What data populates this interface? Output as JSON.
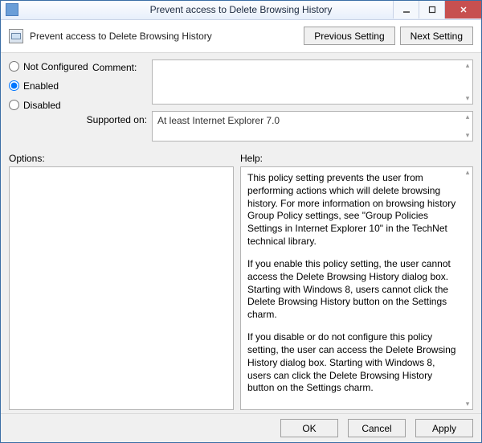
{
  "window": {
    "title": "Prevent access to Delete Browsing History"
  },
  "header": {
    "title": "Prevent access to Delete Browsing History",
    "prev_btn": "Previous Setting",
    "next_btn": "Next Setting"
  },
  "state": {
    "not_configured_label": "Not Configured",
    "enabled_label": "Enabled",
    "disabled_label": "Disabled",
    "selected": "enabled"
  },
  "comment": {
    "label": "Comment:",
    "value": ""
  },
  "supported": {
    "label": "Supported on:",
    "value": "At least Internet Explorer 7.0"
  },
  "options": {
    "label": "Options:"
  },
  "help": {
    "label": "Help:",
    "p1": "This policy setting prevents the user from performing actions which will delete browsing history. For more information on browsing history Group Policy settings, see \"Group Policies Settings in Internet Explorer 10\" in the TechNet technical library.",
    "p2": "If you enable this policy setting, the user cannot access the Delete Browsing History dialog box. Starting with Windows 8, users cannot click the Delete Browsing History button on the Settings charm.",
    "p3": "If you disable or do not configure this policy setting, the user can access the Delete Browsing History dialog box. Starting with Windows 8, users can click the Delete Browsing History button on the Settings charm."
  },
  "footer": {
    "ok": "OK",
    "cancel": "Cancel",
    "apply": "Apply"
  }
}
